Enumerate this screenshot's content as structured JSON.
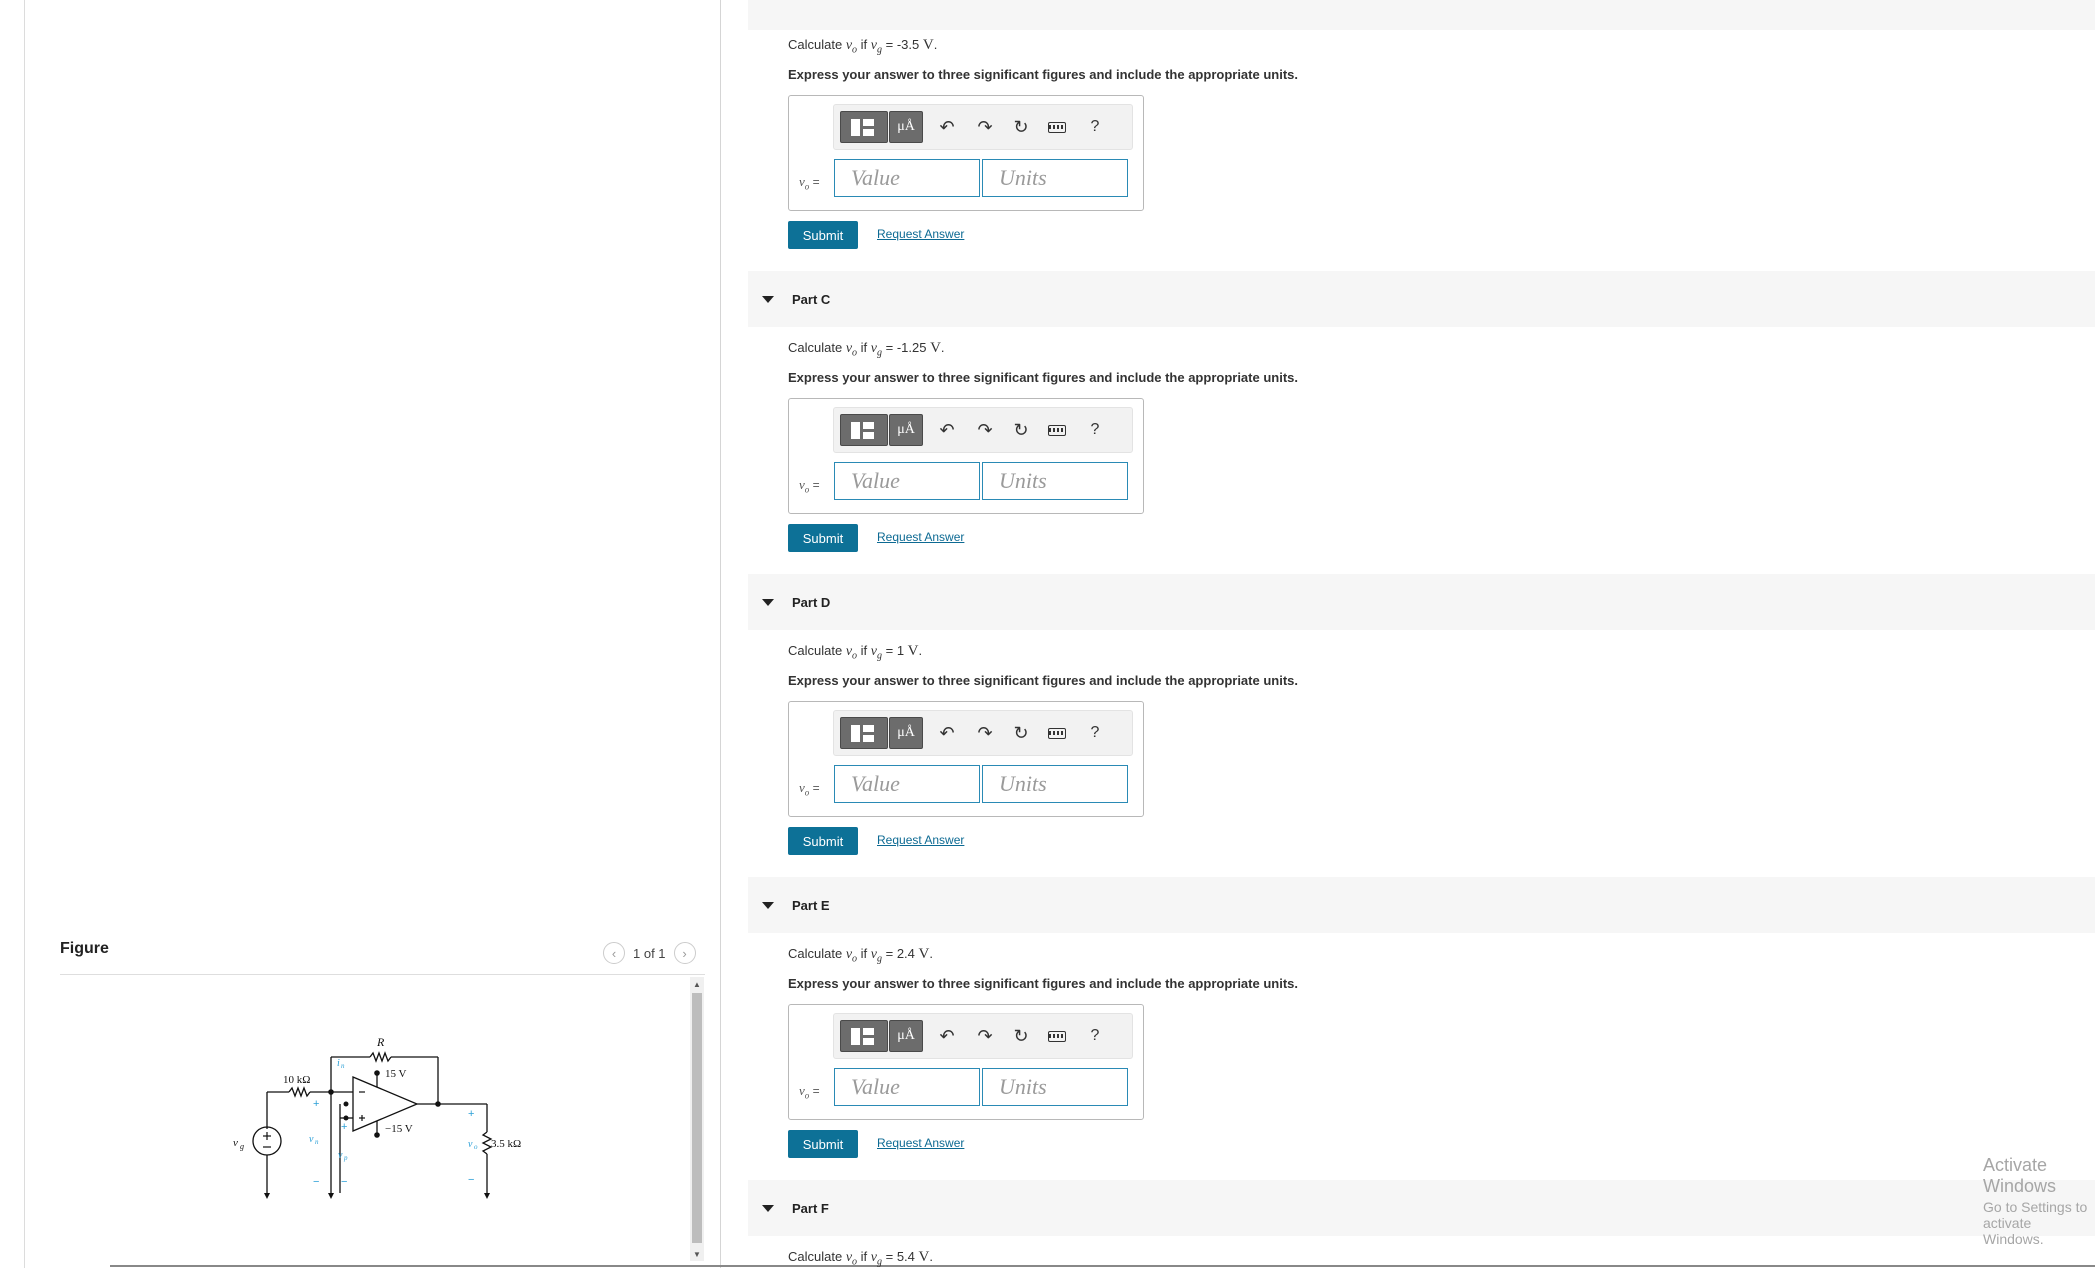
{
  "figure": {
    "title": "Figure",
    "pager": "1 of 1",
    "prev_icon": "chevron-left-icon",
    "next_icon": "chevron-right-icon"
  },
  "circuit_labels": {
    "r": "R",
    "r_in": "10 kΩ",
    "vplus": "15 V",
    "vminus": "−15 V",
    "vg": "v",
    "vg_sub": "g",
    "vn": "v",
    "vn_sub": "n",
    "vp": "v",
    "vp_sub": "p",
    "vo": "v",
    "vo_sub": "o",
    "rl": "3.5 kΩ",
    "in": "i",
    "in_sub": "n",
    "plus": "+",
    "minus": "−"
  },
  "common": {
    "instruction": "Express your answer to three significant figures and include the appropriate units.",
    "var_label": "v",
    "var_sub": "o",
    "equals": " =",
    "value_placeholder": "Value",
    "units_placeholder": "Units",
    "units_button": "μÅ",
    "help": "?",
    "submit": "Submit",
    "request": "Request Answer",
    "calc": "Calculate ",
    "if_text": " if ",
    "eq": " = "
  },
  "parts": [
    {
      "id": "B",
      "label": "",
      "vg": "-3.5",
      "unit": "V"
    },
    {
      "id": "C",
      "label": "Part C",
      "vg": "-1.25",
      "unit": "V"
    },
    {
      "id": "D",
      "label": "Part D",
      "vg": "1",
      "unit": "V"
    },
    {
      "id": "E",
      "label": "Part E",
      "vg": "2.4",
      "unit": "V"
    },
    {
      "id": "F",
      "label": "Part F",
      "vg": "5.4",
      "unit": "V"
    }
  ],
  "watermark": {
    "line1": "Activate Windows",
    "line2": "Go to Settings to activate Windows."
  }
}
